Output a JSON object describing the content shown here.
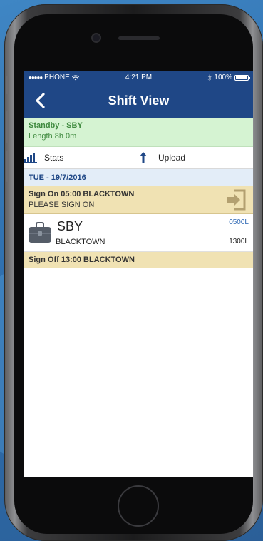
{
  "status_bar": {
    "carrier": "PHONE",
    "time": "4:21 PM",
    "battery": "100%"
  },
  "nav": {
    "title": "Shift View"
  },
  "standby": {
    "title": "Standby - SBY",
    "length": "Length 8h 0m"
  },
  "toolbar": {
    "stats_label": "Stats",
    "upload_label": "Upload"
  },
  "date_header": "TUE - 19/7/2016",
  "sign_on": {
    "title": "Sign On 05:00 BLACKTOWN",
    "message": "PLEASE SIGN ON"
  },
  "duty": {
    "code": "SBY",
    "location": "BLACKTOWN",
    "start": "0500L",
    "end": "1300L"
  },
  "sign_off": {
    "title": "Sign Off 13:00 BLACKTOWN"
  },
  "colors": {
    "nav_blue": "#1f4786",
    "standby_green_bg": "#d5f3d2",
    "standby_green_text": "#3f8a3f",
    "signon_tan": "#f0e2b3",
    "date_bg": "#e3edf8",
    "start_time_blue": "#2b66b3"
  },
  "icons": {
    "back": "chevron-left-icon",
    "stats": "bar-chart-icon",
    "upload": "arrow-up-icon",
    "sign_on": "sign-in-icon",
    "duty": "briefcase-icon"
  }
}
